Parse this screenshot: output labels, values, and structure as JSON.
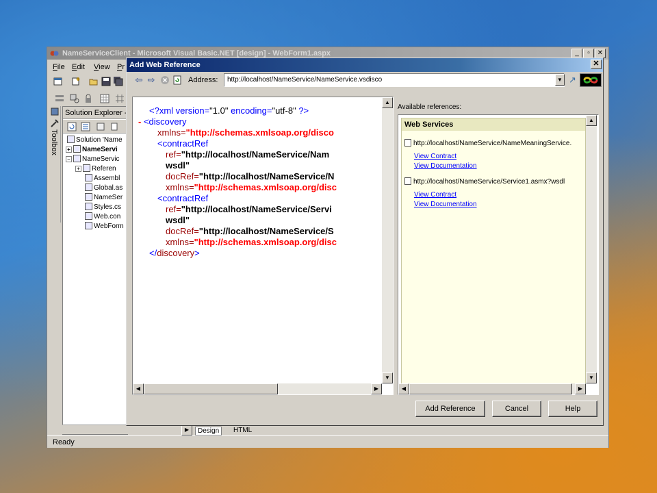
{
  "ide": {
    "title": "NameServiceClient - Microsoft Visual Basic.NET [design] - WebForm1.aspx",
    "menu": [
      {
        "key": "F",
        "rest": "ile"
      },
      {
        "key": "E",
        "rest": "dit"
      },
      {
        "key": "V",
        "rest": "iew"
      },
      {
        "key": "P",
        "rest": "r"
      }
    ],
    "solution_explorer": {
      "title": "Solution Explorer -",
      "items": [
        "Solution 'Name",
        "NameServi",
        "NameServic",
        "Referen",
        "Assembl",
        "Global.as",
        "NameSer",
        "Styles.cs",
        "Web.con",
        "WebForm"
      ]
    },
    "toolbox_label": "Toolbox",
    "view_tabs": {
      "design": "Design",
      "html": "HTML"
    },
    "status": "Ready"
  },
  "dialog": {
    "title": "Add Web Reference",
    "close": "✕",
    "address_label": "Address:",
    "address_value": "http://localhost/NameService/NameService.vsdisco",
    "available_label": "Available references:",
    "web_services_header": "Web Services",
    "services": [
      {
        "url": "http://localhost/NameService/NameMeaningService.",
        "view_contract": "View Contract",
        "view_documentation": "View Documentation"
      },
      {
        "url": "http://localhost/NameService/Service1.asmx?wsdl",
        "view_contract": "View Contract",
        "view_documentation": "View Documentation"
      }
    ],
    "buttons": {
      "add_reference": "Add Reference",
      "cancel": "Cancel",
      "help": "Help"
    }
  },
  "xml": {
    "decl_open": "<?xml version=",
    "decl_version": "\"1.0\"",
    "decl_enc_attr": " encoding=",
    "decl_enc": "\"utf-8\"",
    "decl_close": " ?>",
    "minus": "-",
    "discovery_open": " <discovery",
    "xmlns_attr": "xmlns=",
    "disco_ns": "\"http://schemas.xmlsoap.org/disco",
    "contract_open": "<contractRef",
    "ref_attr": "ref=",
    "ref1": "\"http://localhost/NameService/Nam",
    "ref1_cont": "wsdl\"",
    "docref_attr": "docRef=",
    "docref1": "\"http://localhost/NameService/N",
    "scl_ns": "\"http://schemas.xmlsoap.org/disc",
    "ref2": "\"http://localhost/NameService/Servi",
    "ref2_cont": "wsdl\"",
    "docref2": "\"http://localhost/NameService/S",
    "scl_ns2": "\"http://schemas.xmlsoap.org/disc",
    "gt": ">",
    "close_discovery_a": "</",
    "close_discovery_b": "discovery",
    "close_discovery_c": ">"
  }
}
